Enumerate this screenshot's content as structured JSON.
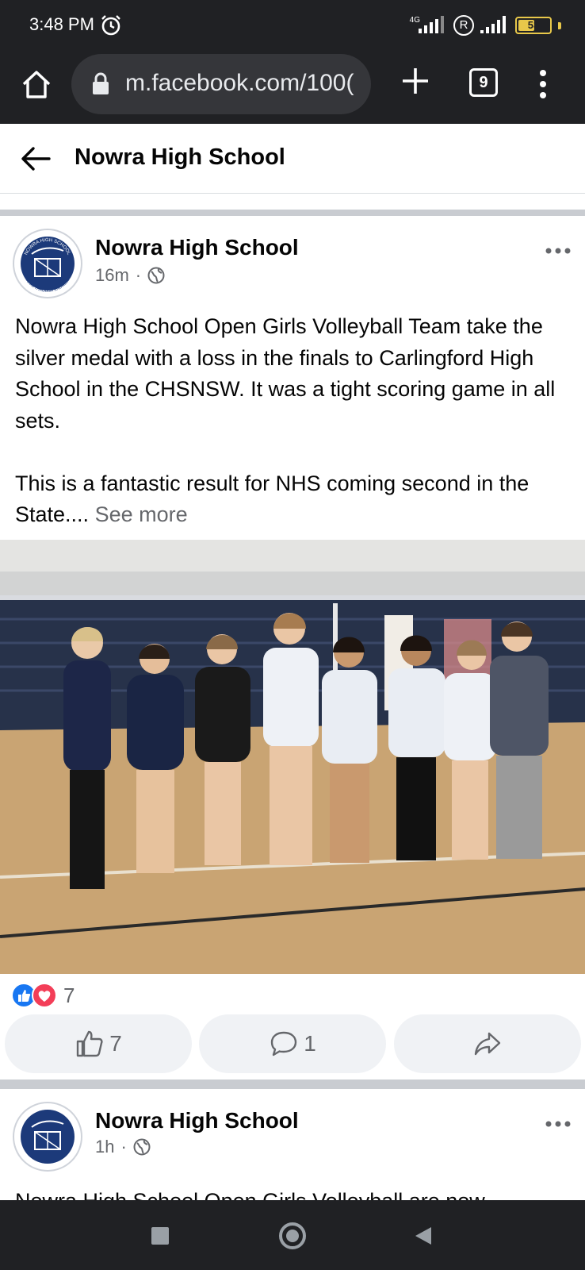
{
  "status_bar": {
    "time": "3:48 PM",
    "network": "4G",
    "roaming": "R",
    "battery": "53",
    "battery_level": 0.53
  },
  "browser": {
    "url": "m.facebook.com/100(",
    "tab_count": "9",
    "icons": [
      "home-icon",
      "lock-icon",
      "plus-icon",
      "tabs-icon",
      "more-vert-icon"
    ]
  },
  "page_header": {
    "title": "Nowra High School"
  },
  "posts": [
    {
      "author": "Nowra High School",
      "time": "16m",
      "separator": "·",
      "avatar_text_top": "NOWRA HIGH SCHOOL",
      "avatar_text_bottom": "WISDOM THROUGH KNOWLEDGE",
      "text_p1": "Nowra High School Open Girls Volleyball Team take the silver medal with a loss in the finals to Carlingford High School in the CHSNSW. It was a tight scoring game in all sets.",
      "text_p2": "This is a fantastic result for NHS coming second in the State....",
      "see_more": "See more",
      "reactions_count": "7",
      "actions": {
        "like_count": "7",
        "comment_count": "1"
      }
    },
    {
      "author": "Nowra High School",
      "time": "1h",
      "separator": "·",
      "text_preview": "Nowra High School Open Girls Volleyball are now"
    }
  ],
  "colors": {
    "brand_blue": "#1877f2",
    "love_red": "#f33e58",
    "school_navy": "#1c3a7a"
  }
}
